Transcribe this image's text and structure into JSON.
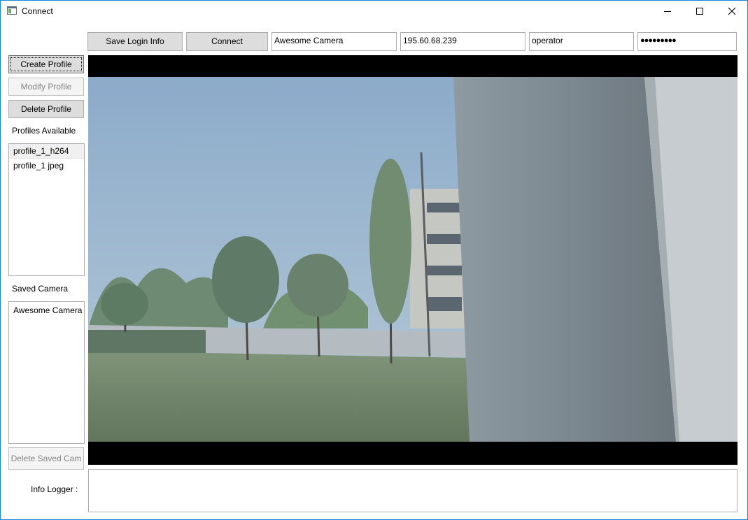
{
  "window": {
    "title": "Connect"
  },
  "toolbar": {
    "save_login_label": "Save Login Info",
    "connect_label": "Connect",
    "camera_name": "Awesome Camera",
    "ip_address": "195.60.68.239",
    "username": "operator",
    "password_masked": "●●●●●●●●●"
  },
  "profile_actions": {
    "create_label": "Create Profile",
    "modify_label": "Modify Profile",
    "delete_label": "Delete Profile"
  },
  "profiles": {
    "heading": "Profiles Available",
    "items": [
      "profile_1_h264",
      "profile_1 jpeg"
    ]
  },
  "saved_camera": {
    "heading": "Saved Camera",
    "items": [
      "Awesome Camera"
    ],
    "delete_label": "Delete Saved Cam"
  },
  "logger": {
    "label": "Info Logger :",
    "text": ""
  },
  "colors": {
    "window_border": "#1883d7",
    "button_bg": "#dddddd",
    "video_bg": "#000000"
  },
  "icons": {
    "minimize": "minimize-icon",
    "maximize": "maximize-icon",
    "close": "close-icon",
    "app": "app-window-icon"
  }
}
